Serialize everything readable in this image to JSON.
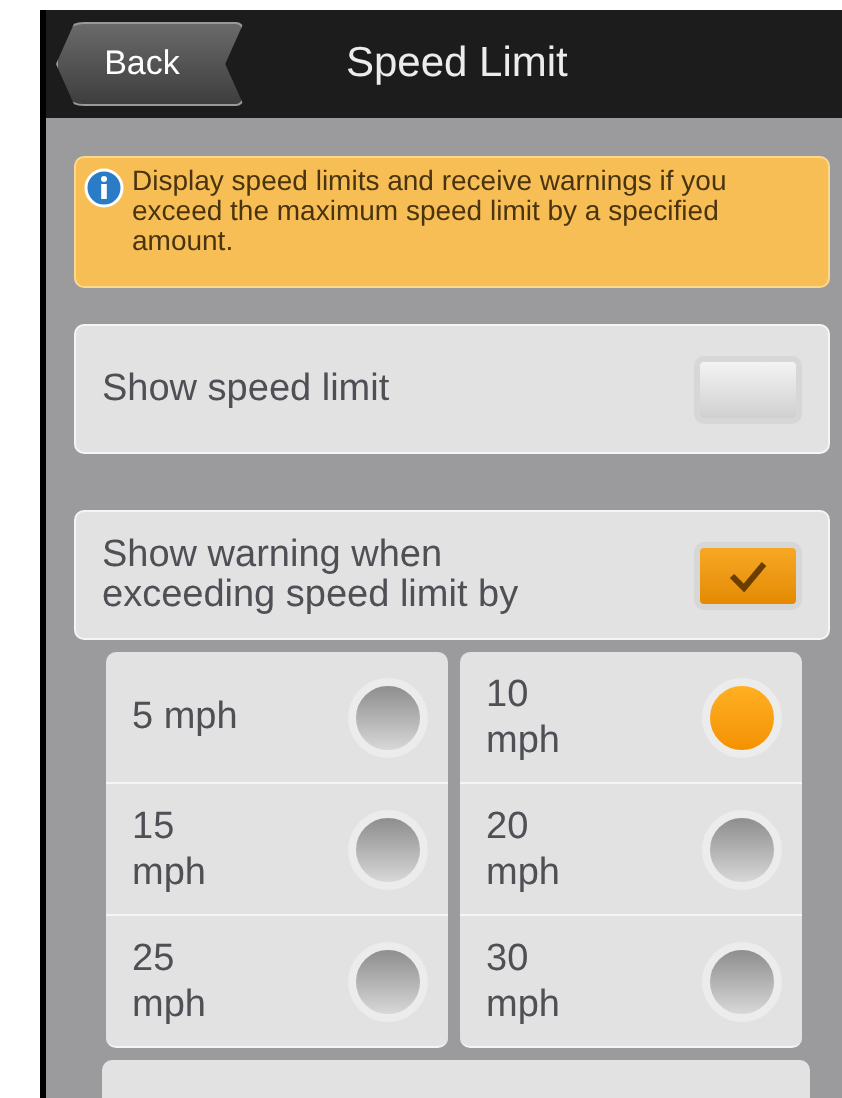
{
  "header": {
    "back": "Back",
    "title": "Speed Limit"
  },
  "info": "Display speed limits and receive warnings if you exceed the maximum speed limit by a specified amount.",
  "settings": [
    {
      "label": "Show speed limit",
      "checked": false
    },
    {
      "label": "Show warning when exceeding speed limit by",
      "checked": true
    }
  ],
  "options": [
    {
      "label": "5 mph",
      "selected": false
    },
    {
      "label": "10 mph",
      "selected": true
    },
    {
      "label": "15 mph",
      "selected": false
    },
    {
      "label": "20 mph",
      "selected": false
    },
    {
      "label": "25 mph",
      "selected": false
    },
    {
      "label": "30 mph",
      "selected": false
    }
  ]
}
